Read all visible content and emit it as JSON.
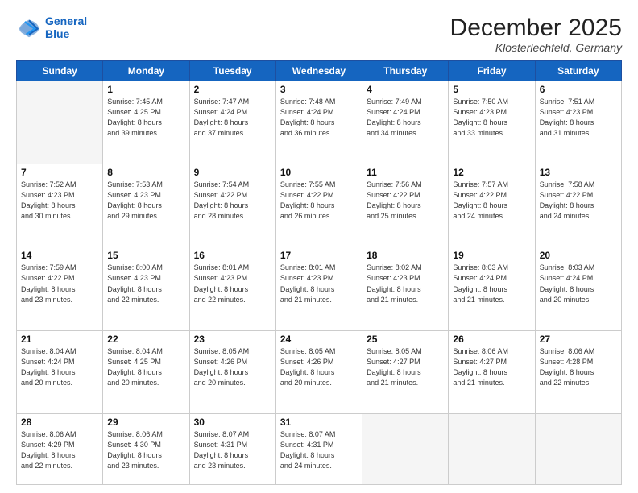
{
  "logo": {
    "line1": "General",
    "line2": "Blue"
  },
  "title": "December 2025",
  "location": "Klosterlechfeld, Germany",
  "days_of_week": [
    "Sunday",
    "Monday",
    "Tuesday",
    "Wednesday",
    "Thursday",
    "Friday",
    "Saturday"
  ],
  "weeks": [
    [
      {
        "day": "",
        "info": ""
      },
      {
        "day": "1",
        "info": "Sunrise: 7:45 AM\nSunset: 4:25 PM\nDaylight: 8 hours\nand 39 minutes."
      },
      {
        "day": "2",
        "info": "Sunrise: 7:47 AM\nSunset: 4:24 PM\nDaylight: 8 hours\nand 37 minutes."
      },
      {
        "day": "3",
        "info": "Sunrise: 7:48 AM\nSunset: 4:24 PM\nDaylight: 8 hours\nand 36 minutes."
      },
      {
        "day": "4",
        "info": "Sunrise: 7:49 AM\nSunset: 4:24 PM\nDaylight: 8 hours\nand 34 minutes."
      },
      {
        "day": "5",
        "info": "Sunrise: 7:50 AM\nSunset: 4:23 PM\nDaylight: 8 hours\nand 33 minutes."
      },
      {
        "day": "6",
        "info": "Sunrise: 7:51 AM\nSunset: 4:23 PM\nDaylight: 8 hours\nand 31 minutes."
      }
    ],
    [
      {
        "day": "7",
        "info": "Sunrise: 7:52 AM\nSunset: 4:23 PM\nDaylight: 8 hours\nand 30 minutes."
      },
      {
        "day": "8",
        "info": "Sunrise: 7:53 AM\nSunset: 4:23 PM\nDaylight: 8 hours\nand 29 minutes."
      },
      {
        "day": "9",
        "info": "Sunrise: 7:54 AM\nSunset: 4:22 PM\nDaylight: 8 hours\nand 28 minutes."
      },
      {
        "day": "10",
        "info": "Sunrise: 7:55 AM\nSunset: 4:22 PM\nDaylight: 8 hours\nand 26 minutes."
      },
      {
        "day": "11",
        "info": "Sunrise: 7:56 AM\nSunset: 4:22 PM\nDaylight: 8 hours\nand 25 minutes."
      },
      {
        "day": "12",
        "info": "Sunrise: 7:57 AM\nSunset: 4:22 PM\nDaylight: 8 hours\nand 24 minutes."
      },
      {
        "day": "13",
        "info": "Sunrise: 7:58 AM\nSunset: 4:22 PM\nDaylight: 8 hours\nand 24 minutes."
      }
    ],
    [
      {
        "day": "14",
        "info": "Sunrise: 7:59 AM\nSunset: 4:22 PM\nDaylight: 8 hours\nand 23 minutes."
      },
      {
        "day": "15",
        "info": "Sunrise: 8:00 AM\nSunset: 4:23 PM\nDaylight: 8 hours\nand 22 minutes."
      },
      {
        "day": "16",
        "info": "Sunrise: 8:01 AM\nSunset: 4:23 PM\nDaylight: 8 hours\nand 22 minutes."
      },
      {
        "day": "17",
        "info": "Sunrise: 8:01 AM\nSunset: 4:23 PM\nDaylight: 8 hours\nand 21 minutes."
      },
      {
        "day": "18",
        "info": "Sunrise: 8:02 AM\nSunset: 4:23 PM\nDaylight: 8 hours\nand 21 minutes."
      },
      {
        "day": "19",
        "info": "Sunrise: 8:03 AM\nSunset: 4:24 PM\nDaylight: 8 hours\nand 21 minutes."
      },
      {
        "day": "20",
        "info": "Sunrise: 8:03 AM\nSunset: 4:24 PM\nDaylight: 8 hours\nand 20 minutes."
      }
    ],
    [
      {
        "day": "21",
        "info": "Sunrise: 8:04 AM\nSunset: 4:24 PM\nDaylight: 8 hours\nand 20 minutes."
      },
      {
        "day": "22",
        "info": "Sunrise: 8:04 AM\nSunset: 4:25 PM\nDaylight: 8 hours\nand 20 minutes."
      },
      {
        "day": "23",
        "info": "Sunrise: 8:05 AM\nSunset: 4:26 PM\nDaylight: 8 hours\nand 20 minutes."
      },
      {
        "day": "24",
        "info": "Sunrise: 8:05 AM\nSunset: 4:26 PM\nDaylight: 8 hours\nand 20 minutes."
      },
      {
        "day": "25",
        "info": "Sunrise: 8:05 AM\nSunset: 4:27 PM\nDaylight: 8 hours\nand 21 minutes."
      },
      {
        "day": "26",
        "info": "Sunrise: 8:06 AM\nSunset: 4:27 PM\nDaylight: 8 hours\nand 21 minutes."
      },
      {
        "day": "27",
        "info": "Sunrise: 8:06 AM\nSunset: 4:28 PM\nDaylight: 8 hours\nand 22 minutes."
      }
    ],
    [
      {
        "day": "28",
        "info": "Sunrise: 8:06 AM\nSunset: 4:29 PM\nDaylight: 8 hours\nand 22 minutes."
      },
      {
        "day": "29",
        "info": "Sunrise: 8:06 AM\nSunset: 4:30 PM\nDaylight: 8 hours\nand 23 minutes."
      },
      {
        "day": "30",
        "info": "Sunrise: 8:07 AM\nSunset: 4:31 PM\nDaylight: 8 hours\nand 23 minutes."
      },
      {
        "day": "31",
        "info": "Sunrise: 8:07 AM\nSunset: 4:31 PM\nDaylight: 8 hours\nand 24 minutes."
      },
      {
        "day": "",
        "info": ""
      },
      {
        "day": "",
        "info": ""
      },
      {
        "day": "",
        "info": ""
      }
    ]
  ]
}
